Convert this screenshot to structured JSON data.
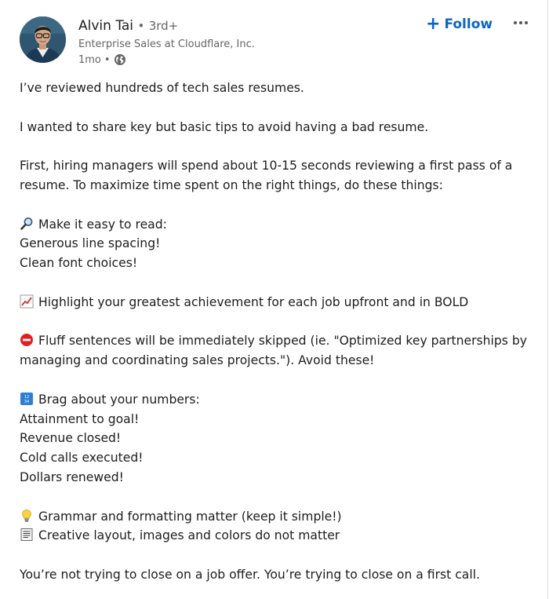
{
  "author": {
    "name": "Alvin Tai",
    "separator": "•",
    "degree": "3rd+",
    "headline": "Enterprise Sales at Cloudflare, Inc.",
    "time": "1mo",
    "visibility_separator": "•",
    "visibility_icon": "globe-icon"
  },
  "actions": {
    "follow_label": "Follow",
    "follow_icon": "plus-icon",
    "more_icon": "ellipsis-icon"
  },
  "colors": {
    "accent": "#0a66c2",
    "text": "#1d1d1d",
    "muted": "#666666"
  },
  "post": {
    "intro": "I’ve reviewed hundreds of tech sales resumes.",
    "purpose": "I wanted to share key but basic tips to avoid having a bad resume.",
    "first_line1": "First, hiring managers will spend about 10-15 seconds reviewing a first pass of a",
    "first_line2": "resume. To maximize time spent on the right things, do these things:",
    "tip1_title": "Make it easy to read:",
    "tip1_item1": "Generous line spacing!",
    "tip1_item2": "Clean font choices!",
    "tip2": "Highlight your greatest achievement for each job upfront and in BOLD",
    "tip3_line1": "Fluff sentences will be immediately skipped (ie. \"Optimized key partnerships by",
    "tip3_line2": "managing and coordinating sales projects.\"). Avoid these!",
    "tip4_title": "Brag about your numbers:",
    "tip4_item1": "Attainment to goal!",
    "tip4_item2": "Revenue closed!",
    "tip4_item3": "Cold calls executed!",
    "tip4_item4": "Dollars renewed!",
    "tip5": "Grammar and formatting matter (keep it simple!)",
    "tip6": "Creative layout, images and colors do not matter",
    "closing": "You’re not trying to close on a job offer. You’re trying to close on a first call."
  },
  "emojis": {
    "tip1": "magnifying-glass-icon",
    "tip2": "chart-increasing-icon",
    "tip3": "no-entry-icon",
    "tip4": "input-numbers-icon",
    "tip5": "light-bulb-icon",
    "tip6": "page-facing-up-icon"
  }
}
